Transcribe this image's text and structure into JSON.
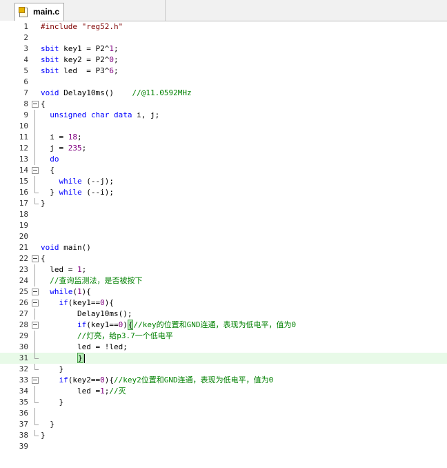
{
  "tab": {
    "title": "main.c"
  },
  "lines": [
    {
      "n": "1",
      "fold": "",
      "hl": false,
      "tokens": [
        {
          "t": "#include \"reg52.h\"",
          "c": "str"
        }
      ]
    },
    {
      "n": "2",
      "fold": "",
      "hl": false,
      "tokens": []
    },
    {
      "n": "3",
      "fold": "",
      "hl": false,
      "tokens": [
        {
          "t": "sbit",
          "c": "kw"
        },
        {
          "t": " key1 = P2^",
          "c": ""
        },
        {
          "t": "1",
          "c": "num"
        },
        {
          "t": ";",
          "c": ""
        }
      ]
    },
    {
      "n": "4",
      "fold": "",
      "hl": false,
      "tokens": [
        {
          "t": "sbit",
          "c": "kw"
        },
        {
          "t": " key2 = P2^",
          "c": ""
        },
        {
          "t": "0",
          "c": "num"
        },
        {
          "t": ";",
          "c": ""
        }
      ]
    },
    {
      "n": "5",
      "fold": "",
      "hl": false,
      "tokens": [
        {
          "t": "sbit",
          "c": "kw"
        },
        {
          "t": " led  = P3^",
          "c": ""
        },
        {
          "t": "6",
          "c": "num"
        },
        {
          "t": ";",
          "c": ""
        }
      ]
    },
    {
      "n": "6",
      "fold": "",
      "hl": false,
      "tokens": []
    },
    {
      "n": "7",
      "fold": "",
      "hl": false,
      "tokens": [
        {
          "t": "void",
          "c": "kw"
        },
        {
          "t": " Delay10ms()    ",
          "c": ""
        },
        {
          "t": "//@11.0592MHz",
          "c": "cm"
        }
      ]
    },
    {
      "n": "8",
      "fold": "open",
      "hl": false,
      "tokens": [
        {
          "t": "{",
          "c": ""
        }
      ]
    },
    {
      "n": "9",
      "fold": "line",
      "hl": false,
      "tokens": [
        {
          "t": "  ",
          "c": ""
        },
        {
          "t": "unsigned",
          "c": "kw"
        },
        {
          "t": " ",
          "c": ""
        },
        {
          "t": "char",
          "c": "kw"
        },
        {
          "t": " ",
          "c": ""
        },
        {
          "t": "data",
          "c": "kw"
        },
        {
          "t": " i, j;",
          "c": ""
        }
      ]
    },
    {
      "n": "10",
      "fold": "line",
      "hl": false,
      "tokens": []
    },
    {
      "n": "11",
      "fold": "line",
      "hl": false,
      "tokens": [
        {
          "t": "  i = ",
          "c": ""
        },
        {
          "t": "18",
          "c": "num"
        },
        {
          "t": ";",
          "c": ""
        }
      ]
    },
    {
      "n": "12",
      "fold": "line",
      "hl": false,
      "tokens": [
        {
          "t": "  j = ",
          "c": ""
        },
        {
          "t": "235",
          "c": "num"
        },
        {
          "t": ";",
          "c": ""
        }
      ]
    },
    {
      "n": "13",
      "fold": "line",
      "hl": false,
      "tokens": [
        {
          "t": "  ",
          "c": ""
        },
        {
          "t": "do",
          "c": "kw"
        }
      ]
    },
    {
      "n": "14",
      "fold": "open",
      "hl": false,
      "tokens": [
        {
          "t": "  {",
          "c": ""
        }
      ]
    },
    {
      "n": "15",
      "fold": "line",
      "hl": false,
      "tokens": [
        {
          "t": "    ",
          "c": ""
        },
        {
          "t": "while",
          "c": "kw"
        },
        {
          "t": " (--j);",
          "c": ""
        }
      ]
    },
    {
      "n": "16",
      "fold": "end",
      "hl": false,
      "tokens": [
        {
          "t": "  } ",
          "c": ""
        },
        {
          "t": "while",
          "c": "kw"
        },
        {
          "t": " (--i);",
          "c": ""
        }
      ]
    },
    {
      "n": "17",
      "fold": "end",
      "hl": false,
      "tokens": [
        {
          "t": "}",
          "c": ""
        }
      ]
    },
    {
      "n": "18",
      "fold": "",
      "hl": false,
      "tokens": []
    },
    {
      "n": "19",
      "fold": "",
      "hl": false,
      "tokens": []
    },
    {
      "n": "20",
      "fold": "",
      "hl": false,
      "tokens": []
    },
    {
      "n": "21",
      "fold": "",
      "hl": false,
      "tokens": [
        {
          "t": "void",
          "c": "kw"
        },
        {
          "t": " main()",
          "c": ""
        }
      ]
    },
    {
      "n": "22",
      "fold": "open",
      "hl": false,
      "tokens": [
        {
          "t": "{",
          "c": ""
        }
      ]
    },
    {
      "n": "23",
      "fold": "line",
      "hl": false,
      "tokens": [
        {
          "t": "  led = ",
          "c": ""
        },
        {
          "t": "1",
          "c": "num"
        },
        {
          "t": ";",
          "c": ""
        }
      ]
    },
    {
      "n": "24",
      "fold": "line",
      "hl": false,
      "tokens": [
        {
          "t": "  ",
          "c": ""
        },
        {
          "t": "//查询监测法，是否被按下",
          "c": "cm"
        }
      ]
    },
    {
      "n": "25",
      "fold": "open",
      "hl": false,
      "tokens": [
        {
          "t": "  ",
          "c": ""
        },
        {
          "t": "while",
          "c": "kw"
        },
        {
          "t": "(",
          "c": ""
        },
        {
          "t": "1",
          "c": "num"
        },
        {
          "t": "){",
          "c": ""
        }
      ]
    },
    {
      "n": "26",
      "fold": "open",
      "hl": false,
      "tokens": [
        {
          "t": "    ",
          "c": ""
        },
        {
          "t": "if",
          "c": "kw"
        },
        {
          "t": "(key1==",
          "c": ""
        },
        {
          "t": "0",
          "c": "num"
        },
        {
          "t": "){",
          "c": ""
        }
      ]
    },
    {
      "n": "27",
      "fold": "line",
      "hl": false,
      "tokens": [
        {
          "t": "        Delay10ms();",
          "c": ""
        }
      ]
    },
    {
      "n": "28",
      "fold": "open",
      "hl": false,
      "tokens": [
        {
          "t": "        ",
          "c": ""
        },
        {
          "t": "if",
          "c": "kw"
        },
        {
          "t": "(key1==",
          "c": ""
        },
        {
          "t": "0",
          "c": "num"
        },
        {
          "t": ")",
          "c": ""
        },
        {
          "t": "{",
          "c": "brace"
        },
        {
          "t": "//key的位置和GND连通，表现为低电平，值为0",
          "c": "cm"
        }
      ]
    },
    {
      "n": "29",
      "fold": "line",
      "hl": false,
      "tokens": [
        {
          "t": "        ",
          "c": ""
        },
        {
          "t": "//灯亮，给p3.7一个低电平",
          "c": "cm"
        }
      ]
    },
    {
      "n": "30",
      "fold": "line",
      "hl": false,
      "tokens": [
        {
          "t": "        led = !led;",
          "c": ""
        }
      ]
    },
    {
      "n": "31",
      "fold": "end",
      "hl": true,
      "tokens": [
        {
          "t": "        ",
          "c": ""
        },
        {
          "t": "}",
          "c": "brace"
        },
        {
          "t": "",
          "c": "caret"
        }
      ]
    },
    {
      "n": "32",
      "fold": "end",
      "hl": false,
      "tokens": [
        {
          "t": "    }",
          "c": ""
        }
      ]
    },
    {
      "n": "33",
      "fold": "open",
      "hl": false,
      "tokens": [
        {
          "t": "    ",
          "c": ""
        },
        {
          "t": "if",
          "c": "kw"
        },
        {
          "t": "(key2==",
          "c": ""
        },
        {
          "t": "0",
          "c": "num"
        },
        {
          "t": "){",
          "c": ""
        },
        {
          "t": "//key2位置和GND连通，表现为低电平，值为0",
          "c": "cm"
        }
      ]
    },
    {
      "n": "34",
      "fold": "line",
      "hl": false,
      "tokens": [
        {
          "t": "        led =",
          "c": ""
        },
        {
          "t": "1",
          "c": "num"
        },
        {
          "t": ";",
          "c": ""
        },
        {
          "t": "//灭",
          "c": "cm"
        }
      ]
    },
    {
      "n": "35",
      "fold": "end",
      "hl": false,
      "tokens": [
        {
          "t": "    }",
          "c": ""
        }
      ]
    },
    {
      "n": "36",
      "fold": "line",
      "hl": false,
      "tokens": []
    },
    {
      "n": "37",
      "fold": "end",
      "hl": false,
      "tokens": [
        {
          "t": "  }",
          "c": ""
        }
      ]
    },
    {
      "n": "38",
      "fold": "end",
      "hl": false,
      "tokens": [
        {
          "t": "}",
          "c": ""
        }
      ]
    },
    {
      "n": "39",
      "fold": "",
      "hl": false,
      "tokens": []
    }
  ]
}
